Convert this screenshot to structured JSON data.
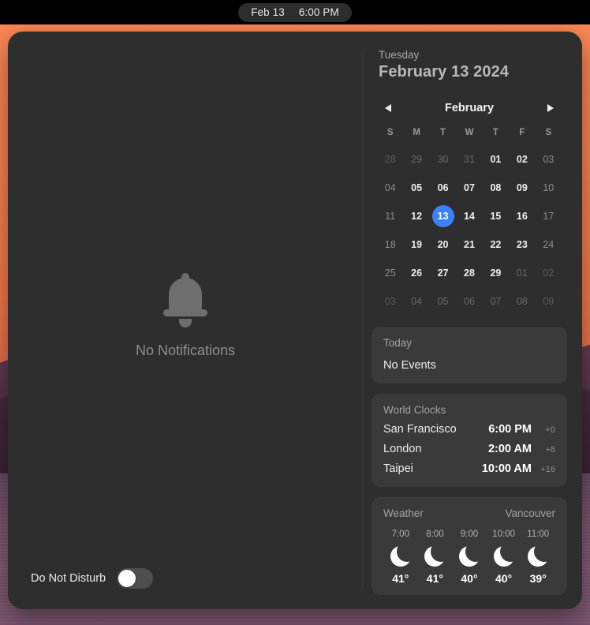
{
  "menubar": {
    "date": "Feb 13",
    "time": "6:00 PM"
  },
  "notifications": {
    "empty_label": "No Notifications",
    "bell_icon": "bell-icon",
    "do_not_disturb": {
      "label": "Do Not Disturb",
      "state": "off"
    }
  },
  "date_header": {
    "weekday": "Tuesday",
    "full_date": "February 13 2024"
  },
  "calendar": {
    "month": "February",
    "prev_icon": "chevron-left-icon",
    "next_icon": "chevron-right-icon",
    "weekday_initials": [
      "S",
      "M",
      "T",
      "W",
      "T",
      "F",
      "S"
    ],
    "weeks": [
      [
        {
          "d": "28",
          "m": "other",
          "w": true
        },
        {
          "d": "29",
          "m": "other",
          "w": false
        },
        {
          "d": "30",
          "m": "other",
          "w": false
        },
        {
          "d": "31",
          "m": "other",
          "w": false
        },
        {
          "d": "01",
          "m": "current",
          "w": false
        },
        {
          "d": "02",
          "m": "current",
          "w": false
        },
        {
          "d": "03",
          "m": "current",
          "w": true
        }
      ],
      [
        {
          "d": "04",
          "m": "current",
          "w": true
        },
        {
          "d": "05",
          "m": "current",
          "w": false
        },
        {
          "d": "06",
          "m": "current",
          "w": false
        },
        {
          "d": "07",
          "m": "current",
          "w": false
        },
        {
          "d": "08",
          "m": "current",
          "w": false
        },
        {
          "d": "09",
          "m": "current",
          "w": false
        },
        {
          "d": "10",
          "m": "current",
          "w": true
        }
      ],
      [
        {
          "d": "11",
          "m": "current",
          "w": true
        },
        {
          "d": "12",
          "m": "current",
          "w": false
        },
        {
          "d": "13",
          "m": "current",
          "w": false,
          "today": true
        },
        {
          "d": "14",
          "m": "current",
          "w": false
        },
        {
          "d": "15",
          "m": "current",
          "w": false
        },
        {
          "d": "16",
          "m": "current",
          "w": false
        },
        {
          "d": "17",
          "m": "current",
          "w": true
        }
      ],
      [
        {
          "d": "18",
          "m": "current",
          "w": true
        },
        {
          "d": "19",
          "m": "current",
          "w": false
        },
        {
          "d": "20",
          "m": "current",
          "w": false
        },
        {
          "d": "21",
          "m": "current",
          "w": false
        },
        {
          "d": "22",
          "m": "current",
          "w": false
        },
        {
          "d": "23",
          "m": "current",
          "w": false
        },
        {
          "d": "24",
          "m": "current",
          "w": true
        }
      ],
      [
        {
          "d": "25",
          "m": "current",
          "w": true
        },
        {
          "d": "26",
          "m": "current",
          "w": false
        },
        {
          "d": "27",
          "m": "current",
          "w": false
        },
        {
          "d": "28",
          "m": "current",
          "w": false
        },
        {
          "d": "29",
          "m": "current",
          "w": false
        },
        {
          "d": "01",
          "m": "other",
          "w": false
        },
        {
          "d": "02",
          "m": "other",
          "w": true
        }
      ],
      [
        {
          "d": "03",
          "m": "other",
          "w": true
        },
        {
          "d": "04",
          "m": "other",
          "w": false
        },
        {
          "d": "05",
          "m": "other",
          "w": false
        },
        {
          "d": "06",
          "m": "other",
          "w": false
        },
        {
          "d": "07",
          "m": "other",
          "w": false
        },
        {
          "d": "08",
          "m": "other",
          "w": false
        },
        {
          "d": "09",
          "m": "other",
          "w": true
        }
      ]
    ],
    "today_highlight_color": "#3b82f6"
  },
  "events_card": {
    "title": "Today",
    "empty": "No Events"
  },
  "world_clocks": {
    "title": "World Clocks",
    "rows": [
      {
        "city": "San Francisco",
        "time": "6:00 PM",
        "offset": "+0"
      },
      {
        "city": "London",
        "time": "2:00 AM",
        "offset": "+8"
      },
      {
        "city": "Taipei",
        "time": "10:00 AM",
        "offset": "+16"
      }
    ]
  },
  "weather": {
    "title": "Weather",
    "location": "Vancouver",
    "hours": [
      {
        "time": "7:00",
        "icon": "moon-icon",
        "temp": "41°"
      },
      {
        "time": "8:00",
        "icon": "moon-icon",
        "temp": "41°"
      },
      {
        "time": "9:00",
        "icon": "moon-icon",
        "temp": "40°"
      },
      {
        "time": "10:00",
        "icon": "moon-icon",
        "temp": "40°"
      },
      {
        "time": "11:00",
        "icon": "moon-icon",
        "temp": "39°"
      }
    ]
  }
}
